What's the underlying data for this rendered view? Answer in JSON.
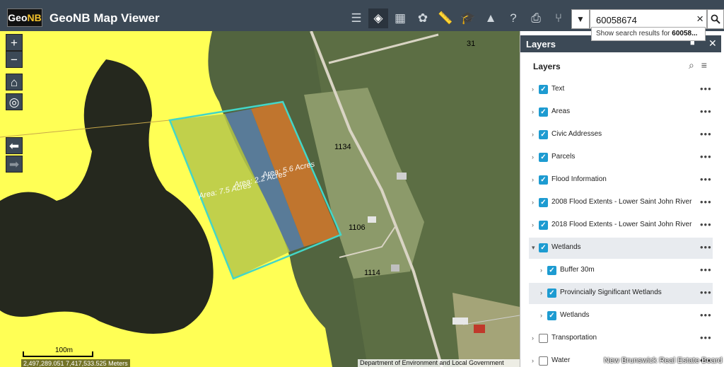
{
  "header": {
    "logo_prefix": "Geo",
    "logo_suffix": "NB",
    "title": "GeoNB Map Viewer",
    "tools": [
      "list-icon",
      "layers-icon",
      "basemap-icon",
      "gallery-icon",
      "measure-icon",
      "education-icon",
      "draw-icon",
      "help-icon",
      "print-icon",
      "share-icon"
    ]
  },
  "search": {
    "value": "60058674",
    "suggestion_prefix": "Show search results for ",
    "suggestion_bold": "60058..."
  },
  "map": {
    "zoom_in": "+",
    "zoom_out": "−",
    "scale_label": "100m",
    "coords": "2,497,289.051 7,417,533.525 Meters",
    "attribution": "Department of Environment and Local Government",
    "areas": [
      {
        "label": "Area: 5.6 Acres"
      },
      {
        "label": "Area: 2.2 Acres"
      },
      {
        "label": "Area: 7.5 Acres"
      }
    ],
    "civic_labels": [
      "31",
      "1134",
      "1106",
      "1114"
    ]
  },
  "panel": {
    "title": "Layers",
    "subtitle": "Layers",
    "layers": [
      {
        "name": "Text",
        "checked": true,
        "level": 0,
        "selected": false
      },
      {
        "name": "Areas",
        "checked": true,
        "level": 0,
        "selected": false
      },
      {
        "name": "Civic Addresses",
        "checked": true,
        "level": 0,
        "selected": false
      },
      {
        "name": "Parcels",
        "checked": true,
        "level": 0,
        "selected": false
      },
      {
        "name": "Flood Information",
        "checked": true,
        "level": 0,
        "selected": false
      },
      {
        "name": "2008 Flood Extents - Lower Saint John River",
        "checked": true,
        "level": 0,
        "selected": false
      },
      {
        "name": "2018 Flood Extents - Lower Saint John River",
        "checked": true,
        "level": 0,
        "selected": false
      },
      {
        "name": "Wetlands",
        "checked": true,
        "level": 0,
        "selected": true,
        "expanded": true
      },
      {
        "name": "Buffer 30m",
        "checked": true,
        "level": 1,
        "selected": false
      },
      {
        "name": "Provincially Significant Wetlands",
        "checked": true,
        "level": 1,
        "selected": true
      },
      {
        "name": "Wetlands",
        "checked": true,
        "level": 1,
        "selected": false
      },
      {
        "name": "Transportation",
        "checked": false,
        "level": 0,
        "selected": false
      },
      {
        "name": "Water",
        "checked": false,
        "level": 0,
        "selected": false
      }
    ]
  },
  "watermark": "New Brunswick Real Estate Board",
  "colors": {
    "header": "#3c4956",
    "wetland_fill": "#ffff55",
    "checkbox": "#1d9bd1",
    "area_orange": "#d4782c",
    "area_blue": "#5b7fa8",
    "area_green": "#b6c84a",
    "outline": "#43d6c8"
  }
}
